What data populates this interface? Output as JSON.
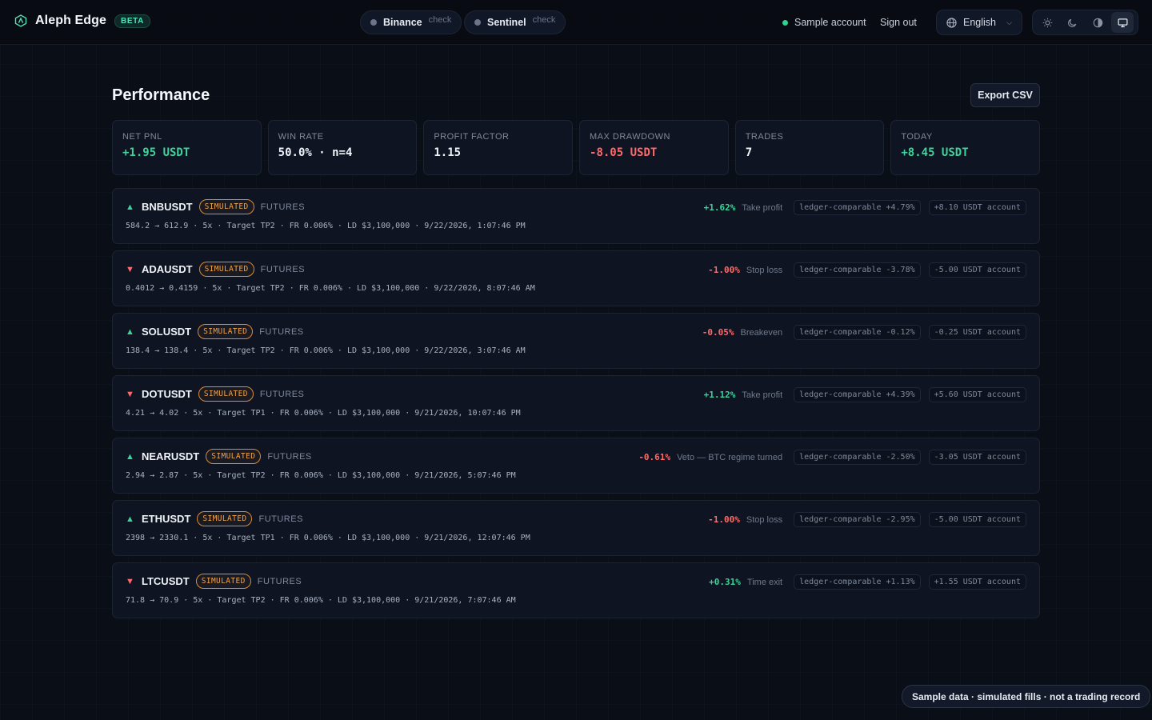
{
  "header": {
    "brand": "Aleph Edge",
    "badge": "BETA",
    "services": [
      {
        "name": "Binance",
        "status": "check"
      },
      {
        "name": "Sentinel",
        "status": "check"
      }
    ],
    "account": "Sample account",
    "sign_out": "Sign out",
    "language": "English",
    "theme_modes": [
      "sun-icon",
      "moon-icon",
      "contrast-icon",
      "monitor-icon"
    ],
    "active_theme": "monitor-icon"
  },
  "page": {
    "title": "Performance",
    "export_label": "Export CSV"
  },
  "stats": [
    {
      "label": "NET PNL",
      "value": "+1.95 USDT",
      "tone": "pos"
    },
    {
      "label": "WIN RATE",
      "value": "50.0% · n=4",
      "tone": "wht"
    },
    {
      "label": "PROFIT FACTOR",
      "value": "1.15",
      "tone": "wht"
    },
    {
      "label": "MAX DRAWDOWN",
      "value": "-8.05 USDT",
      "tone": "neg"
    },
    {
      "label": "TRADES",
      "value": "7",
      "tone": "wht"
    },
    {
      "label": "TODAY",
      "value": "+8.45 USDT",
      "tone": "pos"
    }
  ],
  "trades": [
    {
      "dir": "up",
      "symbol": "BNBUSDT",
      "badge": "SIMULATED",
      "market": "FUTURES",
      "details": "584.2 → 612.9 · 5x · Target TP2 · FR 0.006% · LD $3,100,000 · 9/22/2026, 1:07:46 PM",
      "pct": "+1.62%",
      "reason": "Take profit",
      "ledger": "ledger-comparable +4.79%",
      "account": "+8.10 USDT account"
    },
    {
      "dir": "down",
      "symbol": "ADAUSDT",
      "badge": "SIMULATED",
      "market": "FUTURES",
      "details": "0.4012 → 0.4159 · 5x · Target TP2 · FR 0.006% · LD $3,100,000 · 9/22/2026, 8:07:46 AM",
      "pct": "-1.00%",
      "reason": "Stop loss",
      "ledger": "ledger-comparable -3.78%",
      "account": "-5.00 USDT account"
    },
    {
      "dir": "up",
      "symbol": "SOLUSDT",
      "badge": "SIMULATED",
      "market": "FUTURES",
      "details": "138.4 → 138.4 · 5x · Target TP2 · FR 0.006% · LD $3,100,000 · 9/22/2026, 3:07:46 AM",
      "pct": "-0.05%",
      "reason": "Breakeven",
      "ledger": "ledger-comparable -0.12%",
      "account": "-0.25 USDT account"
    },
    {
      "dir": "down",
      "symbol": "DOTUSDT",
      "badge": "SIMULATED",
      "market": "FUTURES",
      "details": "4.21 → 4.02 · 5x · Target TP1 · FR 0.006% · LD $3,100,000 · 9/21/2026, 10:07:46 PM",
      "pct": "+1.12%",
      "reason": "Take profit",
      "ledger": "ledger-comparable +4.39%",
      "account": "+5.60 USDT account"
    },
    {
      "dir": "up",
      "symbol": "NEARUSDT",
      "badge": "SIMULATED",
      "market": "FUTURES",
      "details": "2.94 → 2.87 · 5x · Target TP2 · FR 0.006% · LD $3,100,000 · 9/21/2026, 5:07:46 PM",
      "pct": "-0.61%",
      "reason": "Veto — BTC regime turned",
      "ledger": "ledger-comparable -2.50%",
      "account": "-3.05 USDT account"
    },
    {
      "dir": "up",
      "symbol": "ETHUSDT",
      "badge": "SIMULATED",
      "market": "FUTURES",
      "details": "2398 → 2330.1 · 5x · Target TP1 · FR 0.006% · LD $3,100,000 · 9/21/2026, 12:07:46 PM",
      "pct": "-1.00%",
      "reason": "Stop loss",
      "ledger": "ledger-comparable -2.95%",
      "account": "-5.00 USDT account"
    },
    {
      "dir": "down",
      "symbol": "LTCUSDT",
      "badge": "SIMULATED",
      "market": "FUTURES",
      "details": "71.8 → 70.9 · 5x · Target TP2 · FR 0.006% · LD $3,100,000 · 9/21/2026, 7:07:46 AM",
      "pct": "+0.31%",
      "reason": "Time exit",
      "ledger": "ledger-comparable +1.13%",
      "account": "+1.55 USDT account"
    }
  ],
  "footer": {
    "note": "Sample data · simulated fills · not a trading record"
  },
  "colors": {
    "background": "#0a0e17",
    "positive": "#3ed39a",
    "negative": "#ff6a6a",
    "simulated": "#f0a24a",
    "accent": "#4ee3b8"
  }
}
